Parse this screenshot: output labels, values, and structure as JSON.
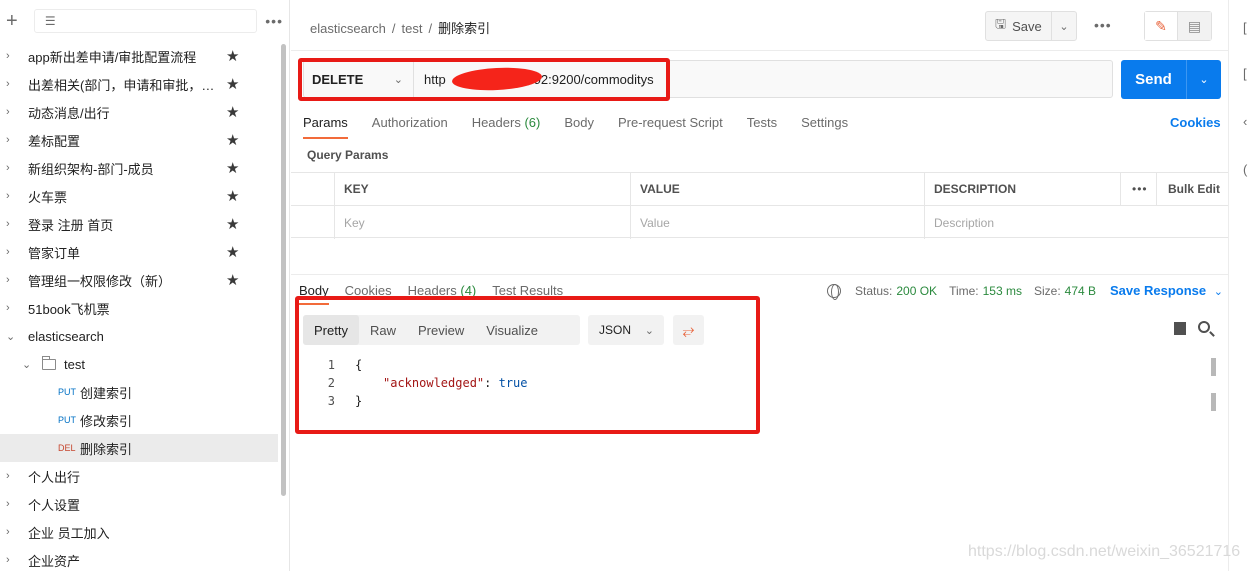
{
  "sidebar": {
    "search_placeholder": "",
    "items": [
      {
        "label": "app新出差申请/审批配置流程",
        "starred": true
      },
      {
        "label": "出差相关(部门，申请和审批，行...",
        "starred": true
      },
      {
        "label": "动态消息/出行",
        "starred": true
      },
      {
        "label": "差标配置",
        "starred": true
      },
      {
        "label": "新组织架构-部门-成员",
        "starred": true
      },
      {
        "label": "火车票",
        "starred": true
      },
      {
        "label": "登录 注册 首页",
        "starred": true
      },
      {
        "label": "管家订单",
        "starred": true
      },
      {
        "label": "管理组一权限修改（新）",
        "starred": true
      },
      {
        "label": "51book飞机票"
      },
      {
        "label": "elasticsearch"
      },
      {
        "label": "test"
      },
      {
        "label": "创建索引",
        "method": "PUT"
      },
      {
        "label": "修改索引",
        "method": "PUT"
      },
      {
        "label": "删除索引",
        "method": "DEL"
      },
      {
        "label": "个人出行"
      },
      {
        "label": "个人设置"
      },
      {
        "label": "企业 员工加入"
      },
      {
        "label": "企业资产"
      }
    ]
  },
  "breadcrumb": {
    "part1": "elasticsearch",
    "part2": "test",
    "current": "删除索引",
    "sep": "/"
  },
  "toolbar": {
    "save_label": "Save"
  },
  "request": {
    "method": "DELETE",
    "url_prefix": "http",
    "url_suffix": "92:9200/commoditys",
    "send_label": "Send"
  },
  "request_tabs": {
    "params": "Params",
    "authorization": "Authorization",
    "headers": "Headers",
    "headers_count": "(6)",
    "body": "Body",
    "pre_request": "Pre-request Script",
    "tests": "Tests",
    "settings": "Settings",
    "cookies": "Cookies"
  },
  "query_params": {
    "title": "Query Params",
    "headers": {
      "key": "KEY",
      "value": "VALUE",
      "description": "DESCRIPTION",
      "bulk_edit": "Bulk Edit"
    },
    "placeholders": {
      "key": "Key",
      "value": "Value",
      "description": "Description"
    }
  },
  "response": {
    "tabs": {
      "body": "Body",
      "cookies": "Cookies",
      "headers": "Headers",
      "headers_count": "(4)",
      "test_results": "Test Results"
    },
    "status_label": "Status:",
    "status_value": "200 OK",
    "time_label": "Time:",
    "time_value": "153 ms",
    "size_label": "Size:",
    "size_value": "474 B",
    "save_response": "Save Response",
    "format_tabs": {
      "pretty": "Pretty",
      "raw": "Raw",
      "preview": "Preview",
      "visualize": "Visualize"
    },
    "format": "JSON",
    "code": {
      "line1_no": "1",
      "line2_no": "2",
      "line3_no": "3",
      "open": "{",
      "key": "\"acknowledged\"",
      "colon": ": ",
      "value": "true",
      "close": "}"
    }
  },
  "watermark": "https://blog.csdn.net/weixin_36521716",
  "colors": {
    "accent": "#097bed",
    "tab_underline": "#f26b3a",
    "annotation": "#e81a16",
    "success": "#2b8a3e"
  }
}
